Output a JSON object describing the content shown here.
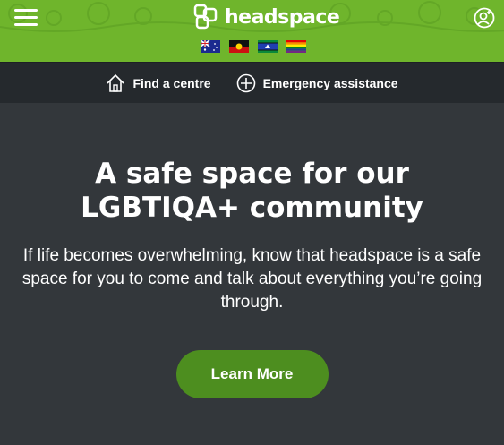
{
  "header": {
    "logo_text": "headspace",
    "brand_color": "#6fb52c",
    "menu_icon": "hamburger-menu-icon",
    "account_icon": "user-account-icon",
    "flags": [
      "australian-flag",
      "aboriginal-flag",
      "torres-strait-islander-flag",
      "rainbow-pride-flag"
    ]
  },
  "actions": {
    "find_centre": "Find a centre",
    "find_centre_icon": "home-icon",
    "emergency": "Emergency assistance",
    "emergency_icon": "plus-circle-icon"
  },
  "hero": {
    "title": "A safe space for our LGBTIQA+ community",
    "body": "If life becomes overwhelming, know that headspace is a safe space for you to come and talk about everything you’re going through.",
    "cta_label": "Learn More",
    "cta_color": "#4d8e1f"
  }
}
